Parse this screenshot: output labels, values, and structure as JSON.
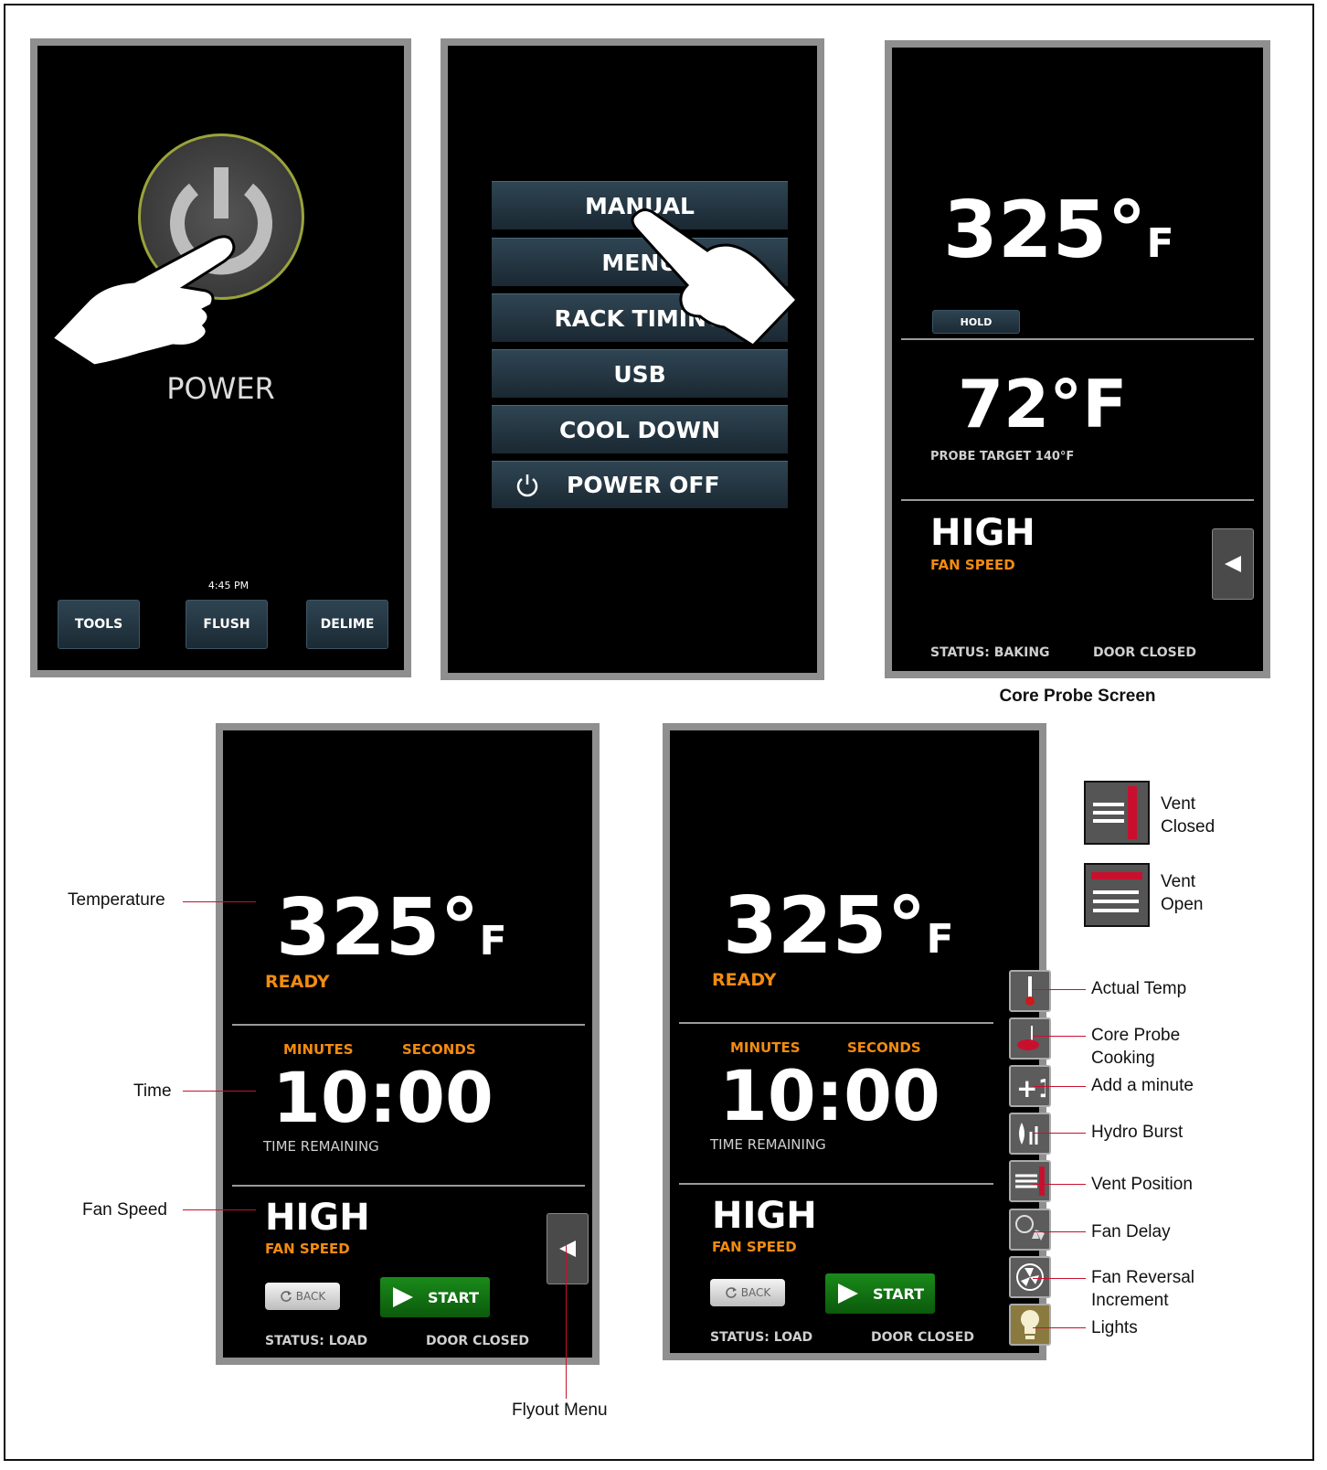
{
  "screen1": {
    "power_label": "POWER",
    "time": "4:45 PM",
    "tools": "TOOLS",
    "flush": "FLUSH",
    "delime": "DELIME"
  },
  "screen2": {
    "items": [
      "MANUAL",
      "MENU",
      "RACK TIMING",
      "USB",
      "COOL DOWN",
      "POWER OFF"
    ]
  },
  "screen3": {
    "temp": "325°",
    "unit": "F",
    "hold": "HOLD",
    "probe_temp": "72°F",
    "probe_target": "PROBE TARGET 140°F",
    "fan": "HIGH",
    "fan_label": "FAN SPEED",
    "status": "STATUS: BAKING",
    "door": "DOOR CLOSED",
    "caption": "Core Probe Screen"
  },
  "screen4": {
    "temp": "325°",
    "unit": "F",
    "ready": "READY",
    "minutes": "MINUTES",
    "seconds": "SECONDS",
    "time": "10:00",
    "time_remaining": "TIME REMAINING",
    "fan": "HIGH",
    "fan_label": "FAN SPEED",
    "back": "BACK",
    "start": "START",
    "status": "STATUS: LOAD",
    "door": "DOOR CLOSED"
  },
  "annotations_left": {
    "temperature": "Temperature",
    "time": "Time",
    "fan_speed": "Fan Speed",
    "flyout": "Flyout Menu"
  },
  "legend": {
    "vent_closed_1": "Vent",
    "vent_closed_2": "Closed",
    "vent_open_1": "Vent",
    "vent_open_2": "Open"
  },
  "annotations_right": {
    "actual_temp": "Actual Temp",
    "core_probe_1": "Core Probe",
    "core_probe_2": "Cooking",
    "add_minute": "Add a minute",
    "hydro_burst": "Hydro Burst",
    "vent_position": "Vent Position",
    "fan_delay": "Fan Delay",
    "fan_reversal_1": "Fan Reversal",
    "fan_reversal_2": "Increment",
    "lights": "Lights"
  },
  "colors": {
    "orange": "#f28b10",
    "leader": "#c8102e",
    "start_green": "#128012",
    "vent_red": "#c8102e"
  }
}
